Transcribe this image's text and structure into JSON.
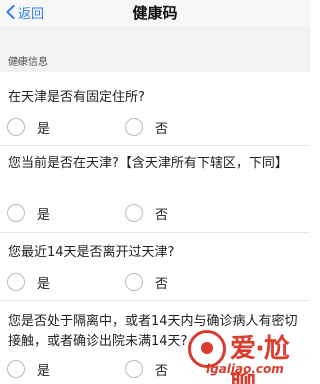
{
  "navbar": {
    "back_label": "返回",
    "title": "健康码"
  },
  "section": {
    "star": "*",
    "title": "健康信息"
  },
  "questions": [
    {
      "text": "在天津是否有固定住所?",
      "options": [
        "是",
        "否"
      ]
    },
    {
      "text": "您当前是否在天津?【含天津所有下辖区，下同】",
      "options": [
        "是",
        "否"
      ]
    },
    {
      "text": "您最近14天是否离开过天津?",
      "options": [
        "是",
        "否"
      ]
    },
    {
      "text": "您是否处于隔离中，或者14天内与确诊病人有密切接触，或者确诊出院未满14天?",
      "options": [
        "是",
        "否"
      ]
    }
  ],
  "watermark": {
    "brand": "爱·尬聊",
    "url": "igaliao.com"
  },
  "colors": {
    "accent": "#2f7df6",
    "section_bg": "#f2f2f2",
    "watermark": "#d93b2e"
  }
}
